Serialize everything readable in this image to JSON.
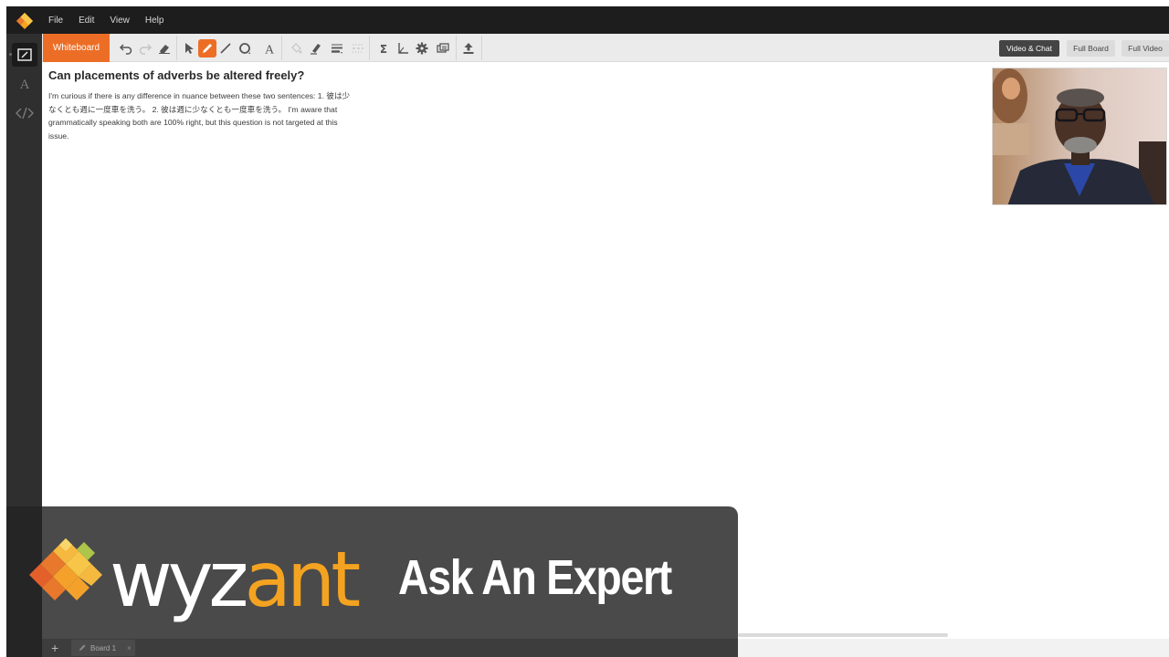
{
  "menu": {
    "items": [
      "File",
      "Edit",
      "View",
      "Help"
    ]
  },
  "toolbar": {
    "whiteboard_tab": "Whiteboard",
    "tools": [
      "undo-icon",
      "redo-icon",
      "eraser-icon",
      "select-arrow-icon",
      "pen-icon",
      "line-icon",
      "shape-circle-icon",
      "text-tool-icon",
      "fill-icon",
      "highlighter-icon",
      "line-style-icon",
      "dash-style-icon",
      "sigma-icon",
      "graph-axes-icon",
      "settings-gear-icon",
      "screen-share-icon",
      "upload-icon"
    ],
    "active_tool": "pen-icon",
    "view_buttons": {
      "video_chat": "Video & Chat",
      "full_board": "Full Board",
      "full_video": "Full Video"
    }
  },
  "question": {
    "title": "Can placements of adverbs be altered freely?",
    "body": "I'm curious if there is any difference in nuance between these two sentences: 1. 彼は少なくとも週に一度車を洗う。 2. 彼は週に少なくとも一度車を洗う。 I'm aware that grammatically speaking both are 100% right, but this question is not targeted at this issue."
  },
  "banner": {
    "brand": "wyzant",
    "tagline": "Ask An Expert"
  },
  "board_tabs": {
    "add": "+",
    "current": "Board 1",
    "close": "×"
  },
  "colors": {
    "accent": "#ec6e26",
    "topbar": "#1d1d1d",
    "sidebar": "#2f2f2f",
    "toolbar": "#ebebeb",
    "banner": "#4a4a4a",
    "brand_orange": "#f4a321"
  }
}
